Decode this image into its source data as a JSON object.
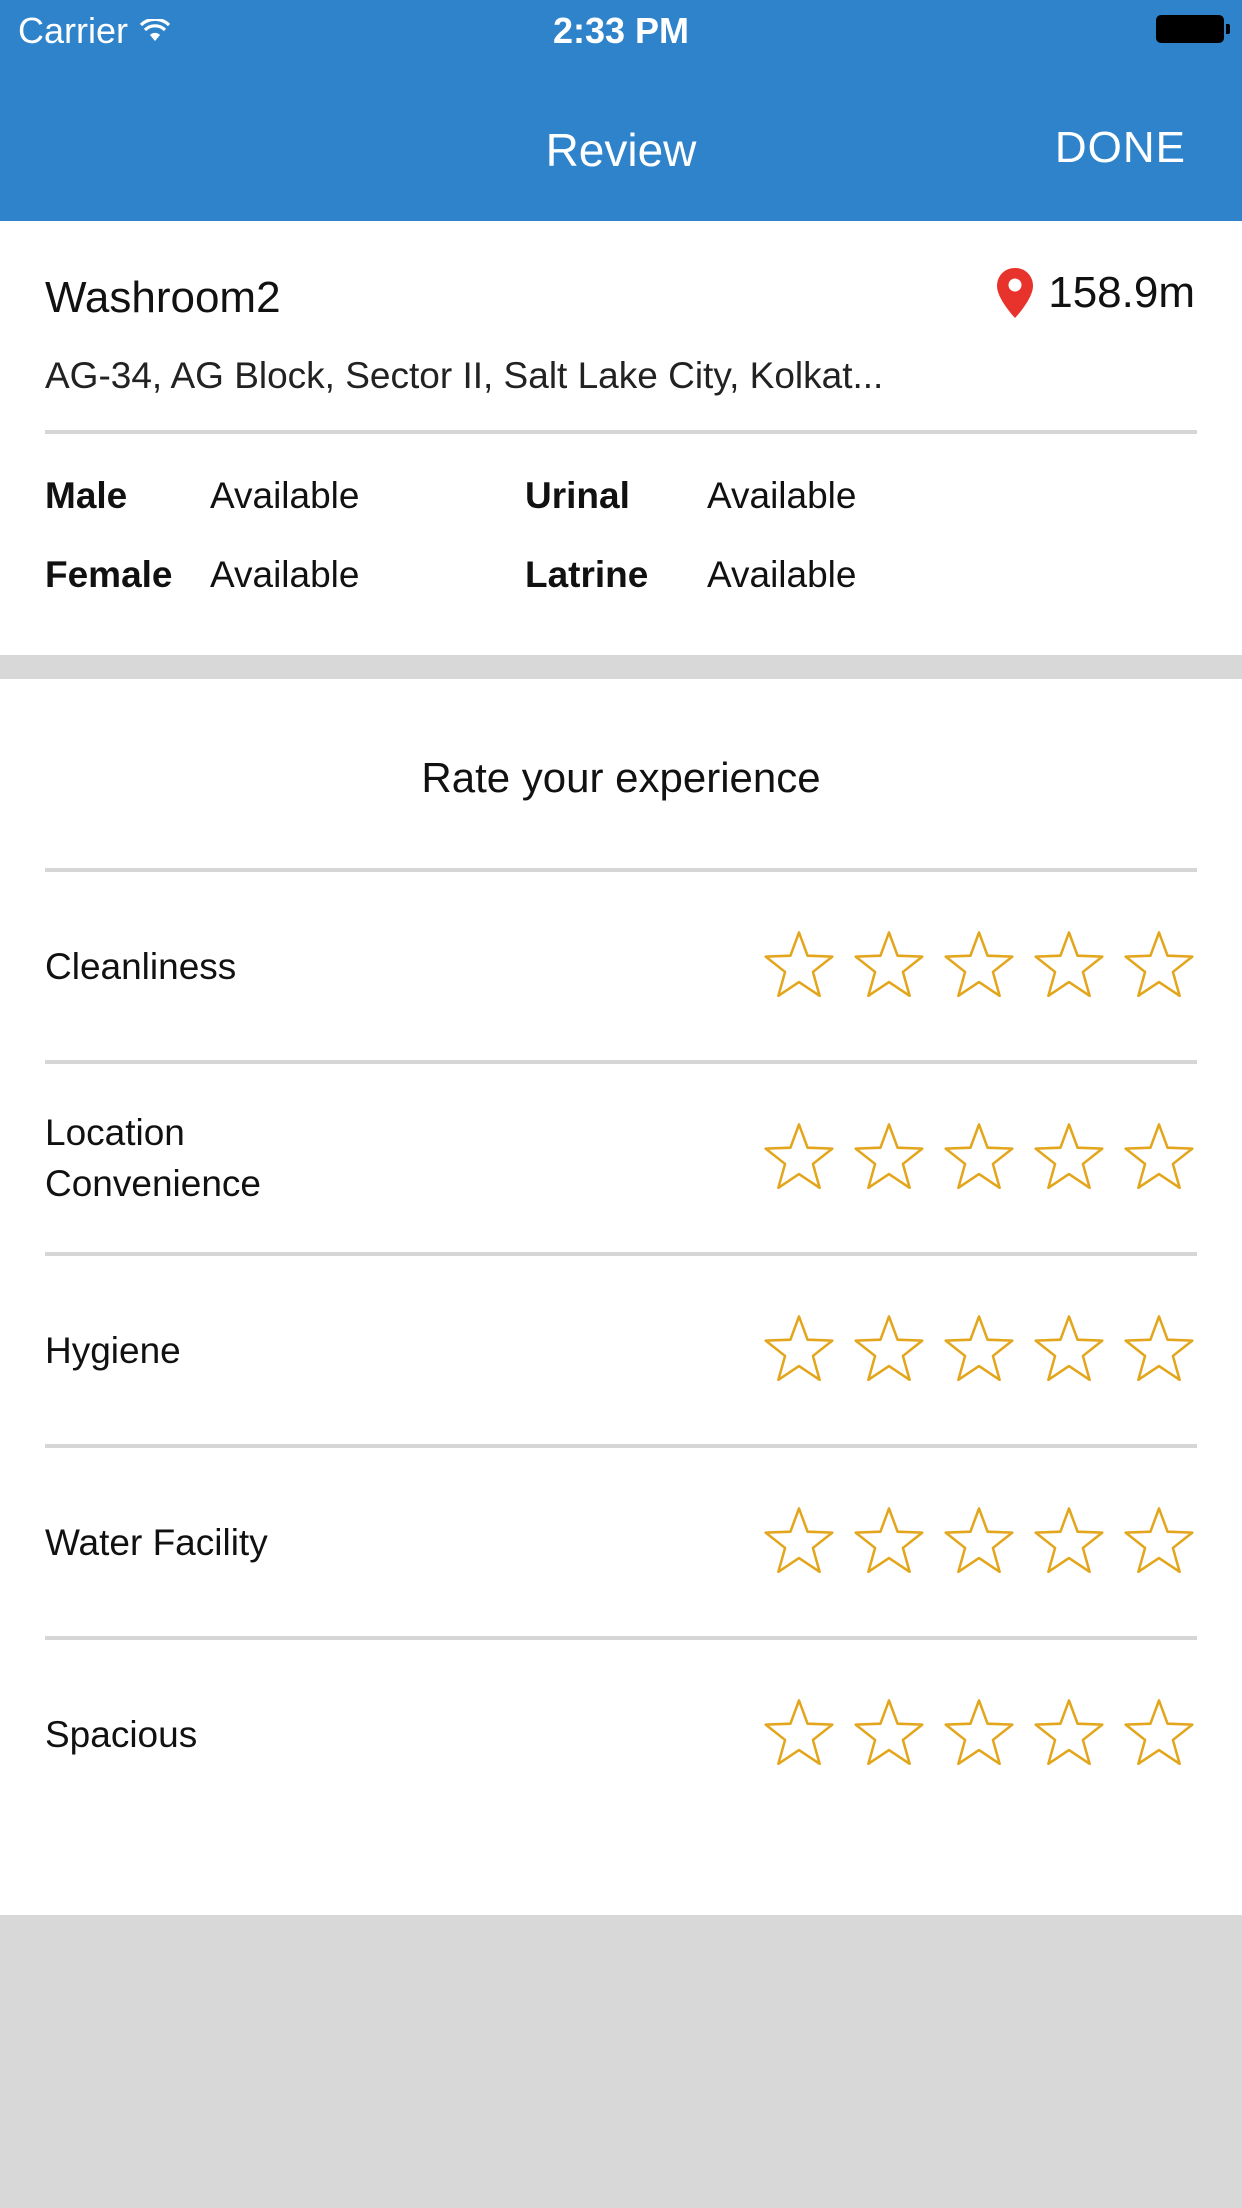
{
  "status_bar": {
    "carrier": "Carrier",
    "time": "2:33 PM"
  },
  "nav": {
    "title": "Review",
    "done_label": "DONE"
  },
  "place": {
    "name": "Washroom2",
    "distance": "158.9m",
    "address": "AG-34, AG Block, Sector II, Salt Lake City, Kolkat..."
  },
  "facilities": [
    {
      "label": "Male",
      "value": "Available"
    },
    {
      "label": "Urinal",
      "value": "Available"
    },
    {
      "label": "Female",
      "value": "Available"
    },
    {
      "label": "Latrine",
      "value": "Available"
    }
  ],
  "rating": {
    "title": "Rate your experience",
    "max_stars": 5,
    "star_color": "#e3a51b",
    "criteria": [
      {
        "label": "Cleanliness",
        "stars": 0
      },
      {
        "label": "Location Convenience",
        "stars": 0
      },
      {
        "label": "Hygiene",
        "stars": 0
      },
      {
        "label": "Water Facility",
        "stars": 0
      },
      {
        "label": "Spacious",
        "stars": 0
      }
    ]
  },
  "colors": {
    "header": "#2e83cb",
    "pin": "#e8322c",
    "background": "#d8d8d8"
  }
}
